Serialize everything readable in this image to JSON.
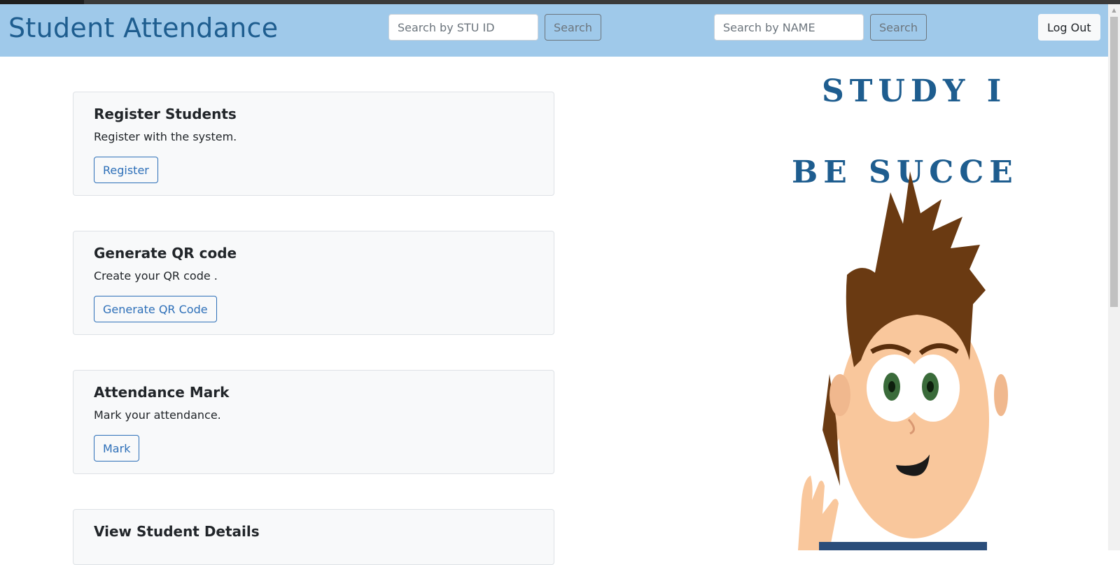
{
  "navbar": {
    "brand": "Student Attendance",
    "search_id": {
      "placeholder": "Search by STU ID",
      "button": "Search"
    },
    "search_name": {
      "placeholder": "Search by NAME",
      "button": "Search"
    },
    "logout": "Log Out"
  },
  "cards": [
    {
      "title": "Register Students",
      "text": "Register with the system.",
      "button": "Register"
    },
    {
      "title": "Generate QR code",
      "text": "Create your QR code .",
      "button": "Generate QR Code"
    },
    {
      "title": "Attendance Mark",
      "text": "Mark your attendance.",
      "button": "Mark"
    },
    {
      "title": "View Student Details",
      "text": "",
      "button": ""
    }
  ],
  "illustration": {
    "line1": "STUDY I",
    "line2": "BE SUCCE"
  },
  "colors": {
    "navbar_bg": "#9fc9ea",
    "brand": "#1e5d8f",
    "outline_button": "#2d6fb8",
    "card_bg": "#f8f9fa"
  }
}
